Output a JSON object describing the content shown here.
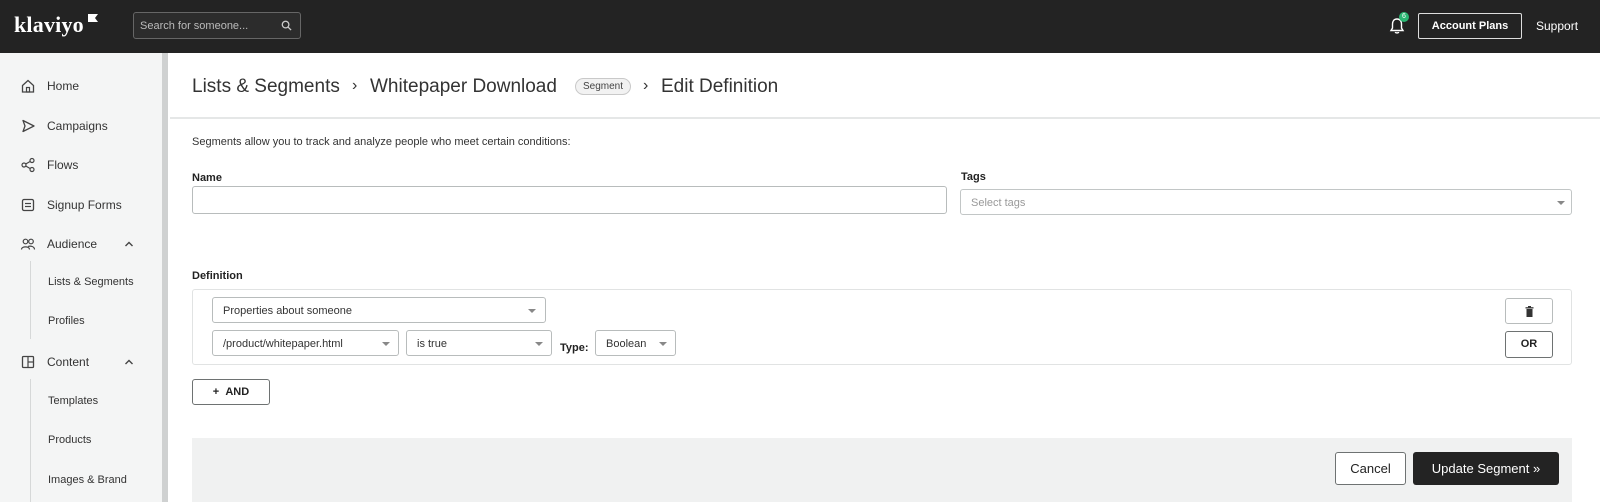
{
  "topbar": {
    "logo": "klaviyo",
    "search": {
      "placeholder": "Search for someone..."
    },
    "notification_count": "6",
    "account_plans_label": "Account Plans",
    "support_label": "Support"
  },
  "sidebar": {
    "items": [
      {
        "label": "Home",
        "icon": "home-icon"
      },
      {
        "label": "Campaigns",
        "icon": "send-icon"
      },
      {
        "label": "Flows",
        "icon": "flow-icon"
      },
      {
        "label": "Signup Forms",
        "icon": "form-icon"
      },
      {
        "label": "Audience",
        "icon": "users-icon",
        "expanded": true,
        "children": [
          {
            "label": "Lists & Segments"
          },
          {
            "label": "Profiles"
          }
        ]
      },
      {
        "label": "Content",
        "icon": "content-icon",
        "expanded": true,
        "children": [
          {
            "label": "Templates"
          },
          {
            "label": "Products"
          },
          {
            "label": "Images & Brand"
          }
        ]
      }
    ]
  },
  "breadcrumb": {
    "items": [
      "Lists & Segments",
      "Whitepaper Download",
      "Edit Definition"
    ],
    "badge": "Segment",
    "separator": "›"
  },
  "form": {
    "intro": "Segments allow you to track and analyze people who meet certain conditions:",
    "name_label": "Name",
    "name_value": "",
    "tags_label": "Tags",
    "tags_placeholder": "Select tags",
    "definition_label": "Definition"
  },
  "definition": {
    "condition_type": "Properties about someone",
    "property": "/product/whitepaper.html",
    "operator": "is true",
    "type_label": "Type:",
    "type_value": "Boolean",
    "or_label": "OR",
    "and_label": "AND"
  },
  "footer": {
    "cancel_label": "Cancel",
    "update_label": "Update Segment »"
  },
  "colors": {
    "topbar_bg": "#232323",
    "sidebar_bg": "#f4f5f5",
    "primary_button": "#232323",
    "notification_badge": "#2bb673",
    "footer_bg": "#f0f1f1"
  }
}
